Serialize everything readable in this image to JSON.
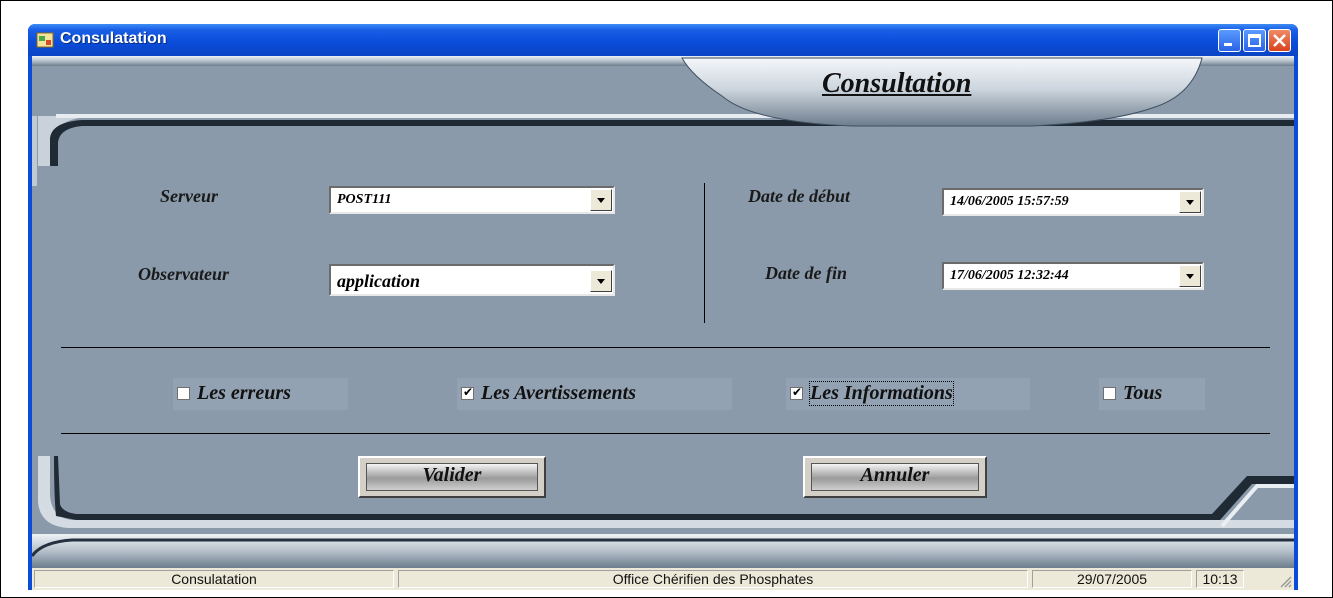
{
  "window": {
    "title": "Consulatation"
  },
  "header": {
    "banner": "Consultation"
  },
  "form": {
    "serveur_label": "Serveur",
    "serveur_value": "POST111",
    "observateur_label": "Observateur",
    "observateur_value": "application",
    "date_debut_label": "Date de début",
    "date_debut_value": "14/06/2005 15:57:59",
    "date_fin_label": "Date de fin",
    "date_fin_value": "17/06/2005 12:32:44"
  },
  "filters": [
    {
      "label": "Les erreurs",
      "checked": false
    },
    {
      "label": "Les Avertissements",
      "checked": true
    },
    {
      "label": "Les Informations",
      "checked": true
    },
    {
      "label": "Tous",
      "checked": false
    }
  ],
  "buttons": {
    "valider": "Valider",
    "annuler": "Annuler"
  },
  "statusbar": {
    "app": "Consulatation",
    "company": "Office Chérifien des Phosphates",
    "date": "29/07/2005",
    "time": "10:13"
  },
  "colors": {
    "titlebar": "#0a4cd8",
    "client_bg": "#8a9aab",
    "statusbar_bg": "#ece9d8"
  }
}
